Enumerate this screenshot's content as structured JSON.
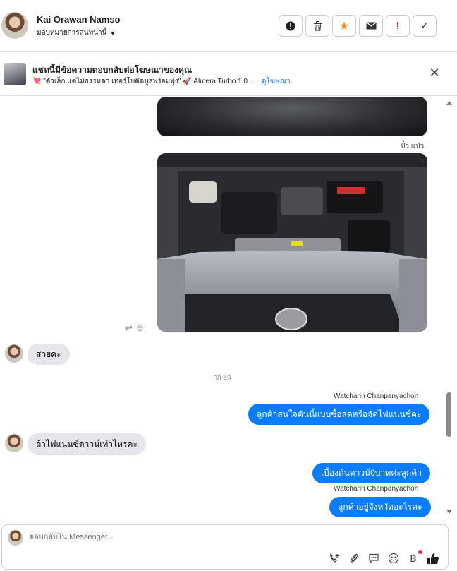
{
  "header": {
    "contact_name": "Kai Orawan Namso",
    "assign_label": "มอบหมายการสนทนานี้",
    "actions": [
      {
        "name": "alert-circle-icon",
        "glyph": "❗"
      },
      {
        "name": "trash-icon",
        "glyph": "🗑"
      },
      {
        "name": "star-icon",
        "glyph": "★"
      },
      {
        "name": "mail-icon",
        "glyph": "✉"
      },
      {
        "name": "spam-exclamation-icon",
        "glyph": "!"
      },
      {
        "name": "check-icon",
        "glyph": "✓"
      }
    ]
  },
  "ad": {
    "title": "แชทนี้มีข้อความตอบกลับต่อโฆษณาของคุณ",
    "subtitle": "💘 \"ตัวเล็ก แต่ไม่ธรรมดา เทอร์โบติดบูสพร้อมพุ่ง\" 🚀 Almera Turbo 1.0 ...",
    "link_label": "ดูโฆษณา"
  },
  "messages": {
    "photo_sender": "ปิ๋ว แป๋ว",
    "incoming_1": "สวยคะ",
    "timestamp": "08:49",
    "agent_name": "Watcharin Chanpanyachon",
    "outgoing_1": "ลูกค้าสนใจคันนี้แบบซื้อสดหรือจัดไฟแนนซ์คะ",
    "incoming_2": "ถ้าไฟแนนซ์ดาวน์เท่าไหรคะ",
    "outgoing_2": "เบื้องต้นดาวน์0บาทค่ะลูกค้า",
    "outgoing_3": "ลูกค้าอยู่จังหวัดอะไรคะ"
  },
  "composer": {
    "placeholder": "ตอบกลับใน Messenger..."
  },
  "colors": {
    "outgoing_bubble": "#0a7cff",
    "incoming_bubble": "#e4e6eb",
    "link": "#1877f2"
  }
}
